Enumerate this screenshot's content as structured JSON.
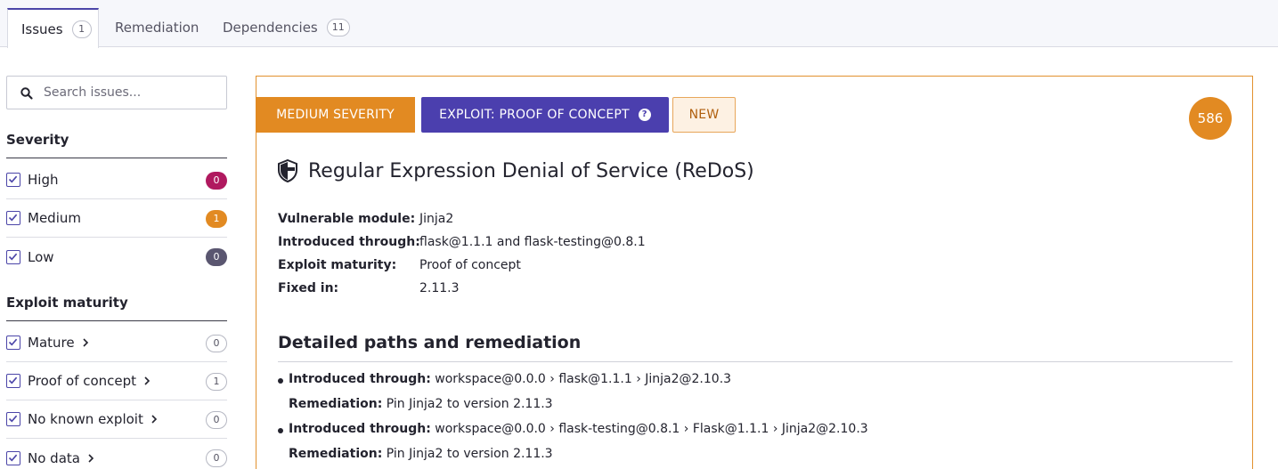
{
  "tabs": [
    {
      "label": "Issues",
      "count": "1"
    },
    {
      "label": "Remediation",
      "count": ""
    },
    {
      "label": "Dependencies",
      "count": "11"
    }
  ],
  "search": {
    "placeholder": "Search issues..."
  },
  "severity": {
    "title": "Severity",
    "items": [
      {
        "label": "High",
        "count": "0",
        "color": "#b0195f"
      },
      {
        "label": "Medium",
        "count": "1",
        "color": "#e28a22"
      },
      {
        "label": "Low",
        "count": "0",
        "color": "#5a5670"
      }
    ]
  },
  "exploit_maturity": {
    "title": "Exploit maturity",
    "items": [
      {
        "label": "Mature",
        "count": "0"
      },
      {
        "label": "Proof of concept",
        "count": "1"
      },
      {
        "label": "No known exploit",
        "count": "0"
      },
      {
        "label": "No data",
        "count": "0"
      }
    ]
  },
  "issue": {
    "severity_label": "MEDIUM SEVERITY",
    "exploit_label": "EXPLOIT: PROOF OF CONCEPT",
    "new_label": "NEW",
    "score": "586",
    "title": "Regular Expression Denial of Service (ReDoS)",
    "details": [
      {
        "key": "Vulnerable module:",
        "value": "Jinja2"
      },
      {
        "key": "Introduced through:",
        "value": "flask@1.1.1 and flask-testing@0.8.1"
      },
      {
        "key": "Exploit maturity:",
        "value": "Proof of concept"
      },
      {
        "key": "Fixed in:",
        "value": "2.11.3"
      }
    ],
    "paths_title": "Detailed paths and remediation",
    "paths": [
      {
        "intro_key": "Introduced through:",
        "intro_value": "workspace@0.0.0 › flask@1.1.1 › Jinja2@2.10.3",
        "rem_key": "Remediation:",
        "rem_value": "Pin Jinja2 to version 2.11.3"
      },
      {
        "intro_key": "Introduced through:",
        "intro_value": "workspace@0.0.0 › flask-testing@0.8.1 › Flask@1.1.1 › Jinja2@2.10.3",
        "rem_key": "Remediation:",
        "rem_value": "Pin Jinja2 to version 2.11.3"
      }
    ]
  }
}
